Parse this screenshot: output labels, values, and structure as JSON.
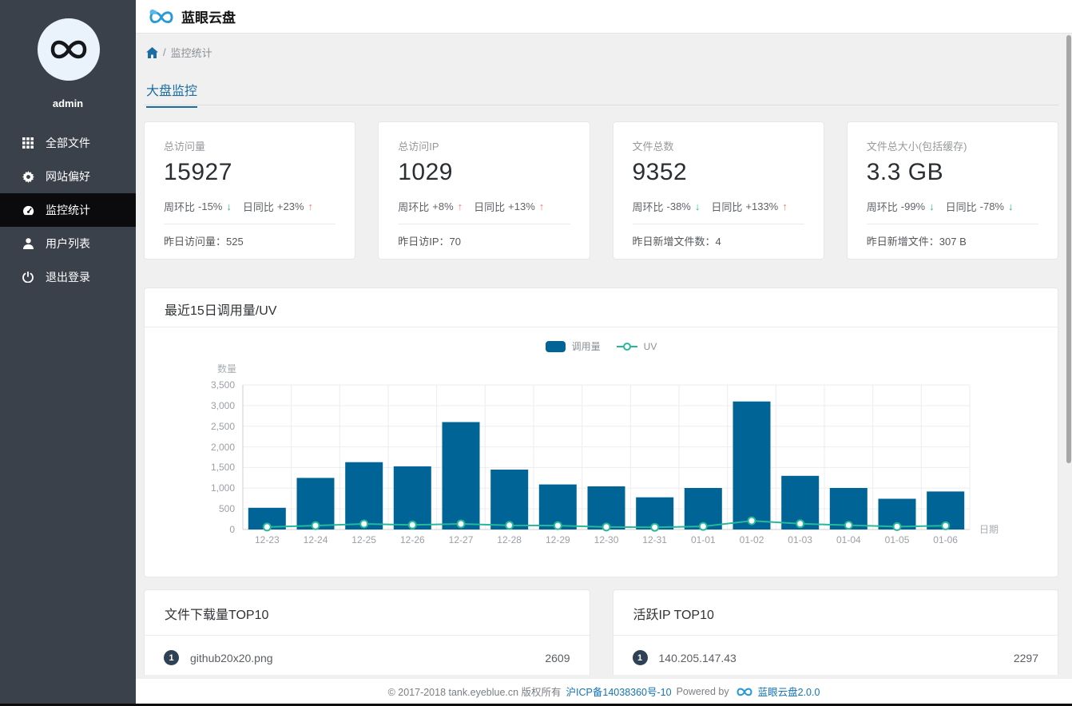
{
  "app": {
    "title": "蓝眼云盘"
  },
  "icons": {
    "up_arrow": "↑",
    "down_arrow": "↓"
  },
  "sidebar": {
    "username": "admin",
    "items": [
      {
        "label": "全部文件"
      },
      {
        "label": "网站偏好"
      },
      {
        "label": "监控统计"
      },
      {
        "label": "用户列表"
      },
      {
        "label": "退出登录"
      }
    ]
  },
  "breadcrumb": {
    "separator": "/",
    "current": "监控统计"
  },
  "tabs": {
    "active": "大盘监控"
  },
  "stat_cards": [
    {
      "label": "总访问量",
      "value": "15927",
      "week_label": "周环比",
      "week_value": "-15%",
      "week_dir": "down",
      "day_label": "日同比",
      "day_value": "+23%",
      "day_dir": "up",
      "foot_label": "昨日访问量：",
      "foot_value": "525"
    },
    {
      "label": "总访问IP",
      "value": "1029",
      "week_label": "周环比",
      "week_value": "+8%",
      "week_dir": "up",
      "day_label": "日同比",
      "day_value": "+13%",
      "day_dir": "up",
      "foot_label": "昨日访IP：",
      "foot_value": "70"
    },
    {
      "label": "文件总数",
      "value": "9352",
      "week_label": "周环比",
      "week_value": "-38%",
      "week_dir": "down",
      "day_label": "日同比",
      "day_value": "+133%",
      "day_dir": "up",
      "foot_label": "昨日新增文件数：",
      "foot_value": "4"
    },
    {
      "label": "文件总大小(包括缓存)",
      "value": "3.3 GB",
      "week_label": "周环比",
      "week_value": "-99%",
      "week_dir": "down",
      "day_label": "日同比",
      "day_value": "-78%",
      "day_dir": "down",
      "foot_label": "昨日新增文件：",
      "foot_value": "307 B"
    }
  ],
  "chart_card": {
    "title": "最近15日调用量/UV"
  },
  "chart_data": {
    "type": "bar",
    "title": "最近15日调用量/UV",
    "categories": [
      "12-23",
      "12-24",
      "12-25",
      "12-26",
      "12-27",
      "12-28",
      "12-29",
      "12-30",
      "12-31",
      "01-01",
      "01-02",
      "01-03",
      "01-04",
      "01-05",
      "01-06"
    ],
    "series": [
      {
        "name": "调用量",
        "type": "bar",
        "color": "#006496",
        "values": [
          525,
          1250,
          1630,
          1530,
          2600,
          1450,
          1090,
          1045,
          780,
          1005,
          3100,
          1300,
          1005,
          745,
          920
        ]
      },
      {
        "name": "UV",
        "type": "line",
        "color": "#26b999",
        "values": [
          60,
          95,
          135,
          110,
          135,
          100,
          95,
          60,
          55,
          75,
          210,
          140,
          105,
          70,
          90
        ]
      }
    ],
    "xlabel": "日期",
    "ylabel": "数量",
    "ylim": [
      0,
      3500
    ],
    "ytick_step": 500,
    "ytick_labels": [
      "0",
      "500",
      "1,000",
      "1,500",
      "2,000",
      "2,500",
      "3,000",
      "3,500"
    ],
    "legend_position": "top-center",
    "grid": true
  },
  "top_lists": [
    {
      "title": "文件下载量TOP10",
      "rows": [
        {
          "rank": "1",
          "name": "github20x20.png",
          "value": "2609"
        }
      ]
    },
    {
      "title": "活跃IP TOP10",
      "rows": [
        {
          "rank": "1",
          "name": "140.205.147.43",
          "value": "2297"
        }
      ]
    }
  ],
  "footer": {
    "copyright": "© 2017-2018 tank.eyeblue.cn 版权所有",
    "icp": "沪ICP备14038360号-10",
    "powered_by": "Powered by",
    "product": "蓝眼云盘2.0.0"
  }
}
